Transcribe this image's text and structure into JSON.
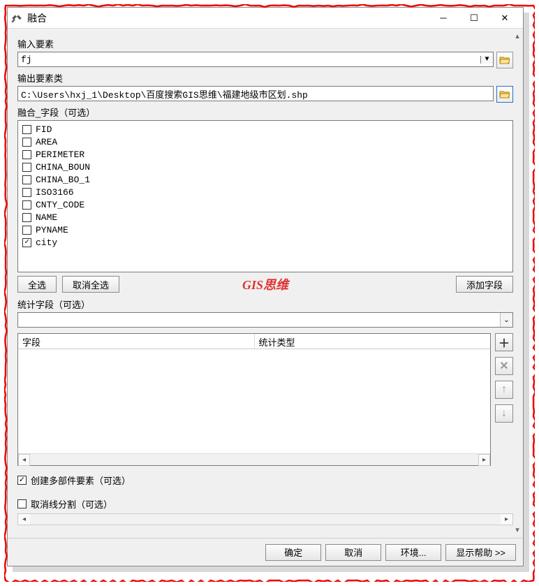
{
  "window": {
    "title": "融合"
  },
  "input_features": {
    "label": "输入要素",
    "value": "fj"
  },
  "output_features": {
    "label": "输出要素类",
    "value": "C:\\Users\\hxj_1\\Desktop\\百度搜索GIS思维\\福建地级市区划.shp"
  },
  "dissolve_fields": {
    "label": "融合_字段（可选）",
    "items": [
      {
        "name": "FID",
        "checked": false
      },
      {
        "name": "AREA",
        "checked": false
      },
      {
        "name": "PERIMETER",
        "checked": false
      },
      {
        "name": "CHINA_BOUN",
        "checked": false
      },
      {
        "name": "CHINA_BO_1",
        "checked": false
      },
      {
        "name": "ISO3166",
        "checked": false
      },
      {
        "name": "CNTY_CODE",
        "checked": false
      },
      {
        "name": "NAME",
        "checked": false
      },
      {
        "name": "PYNAME",
        "checked": false
      },
      {
        "name": "city",
        "checked": true
      }
    ],
    "select_all": "全选",
    "unselect_all": "取消全选",
    "add_field": "添加字段"
  },
  "stat_fields": {
    "label": "统计字段（可选）",
    "selected": "",
    "col_field": "字段",
    "col_type": "统计类型"
  },
  "multipart": {
    "label": "创建多部件要素（可选）",
    "checked": true
  },
  "unsplit": {
    "label": "取消线分割（可选）",
    "checked": false
  },
  "footer": {
    "ok": "确定",
    "cancel": "取消",
    "env": "环境...",
    "help": "显示帮助 >>"
  },
  "watermark": "GIS思维"
}
